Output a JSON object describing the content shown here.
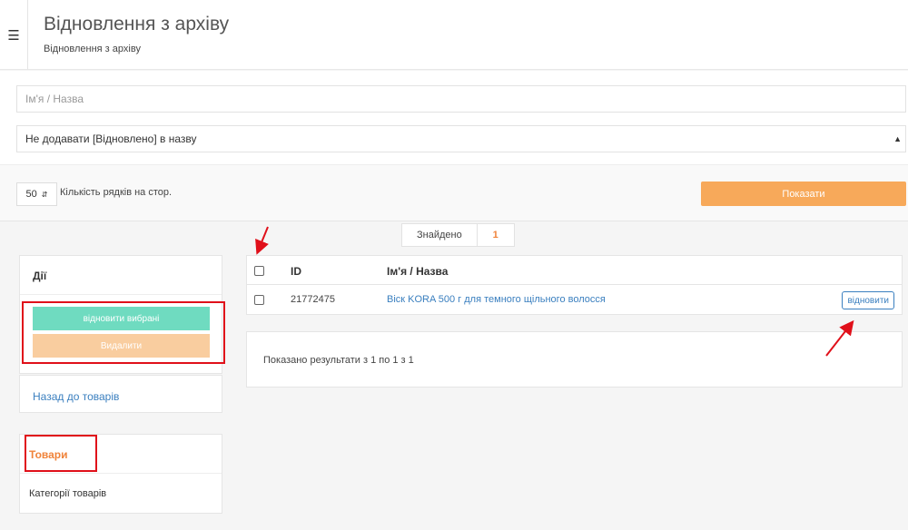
{
  "header": {
    "menu_icon": "hamburger-icon",
    "title": "Відновлення з архіву",
    "subtitle": "Відновлення з архіву"
  },
  "filters": {
    "name_placeholder": "Ім'я / Назва",
    "restore_mode_selected": "Не додавати [Відновлено] в назву"
  },
  "toolbar": {
    "per_page_value": "50",
    "per_page_label": "Кількість рядків на стор.",
    "show_button": "Показати"
  },
  "found": {
    "label": "Знайдено",
    "count": "1"
  },
  "actions": {
    "title": "Дії",
    "restore_selected": "відновити вибрані",
    "delete": "Видалити"
  },
  "back_link": "Назад до товарів",
  "categories": {
    "title": "Товари",
    "link": "Категорії товарів"
  },
  "table": {
    "columns": [
      "ID",
      "Ім'я / Назва"
    ],
    "rows": [
      {
        "id": "21772475",
        "name": "Віск KORA 500 г для темного щільного волосся",
        "action": "відновити"
      }
    ]
  },
  "result_text": "Показано результати з 1 по 1 з 1",
  "colors": {
    "accent_orange": "#f7a95a",
    "teal": "#6fdbc0",
    "annotation_red": "#e0101a",
    "link_blue": "#3a7fbf"
  }
}
